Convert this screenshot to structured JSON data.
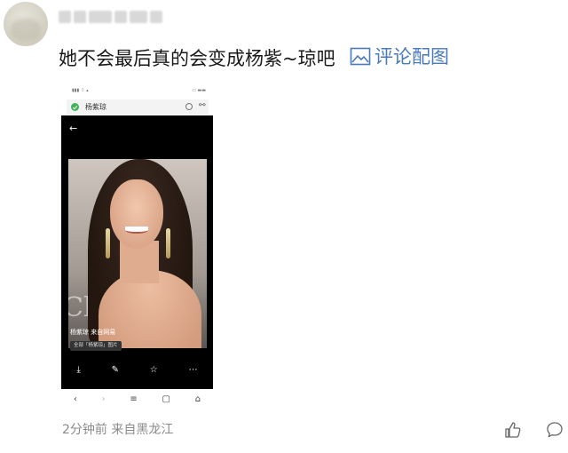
{
  "comment": {
    "author": "",
    "text": "她不会最后真的会变成杨紫~琼吧",
    "image_link_label": "评论配图",
    "timestamp": "2分钟前  来自黑龙江"
  },
  "screenshot": {
    "search_query": "杨紫琼",
    "caption": "杨紫琼 来自网易",
    "chip_label": "全部「杨紫琼」图片",
    "photo_bg_text": "Cl"
  },
  "icons": {
    "like": "thumbs-up-icon",
    "reply": "speech-bubble-icon",
    "image": "image-icon"
  },
  "colors": {
    "link": "#4a7ab8",
    "meta": "#8a8a8a"
  }
}
